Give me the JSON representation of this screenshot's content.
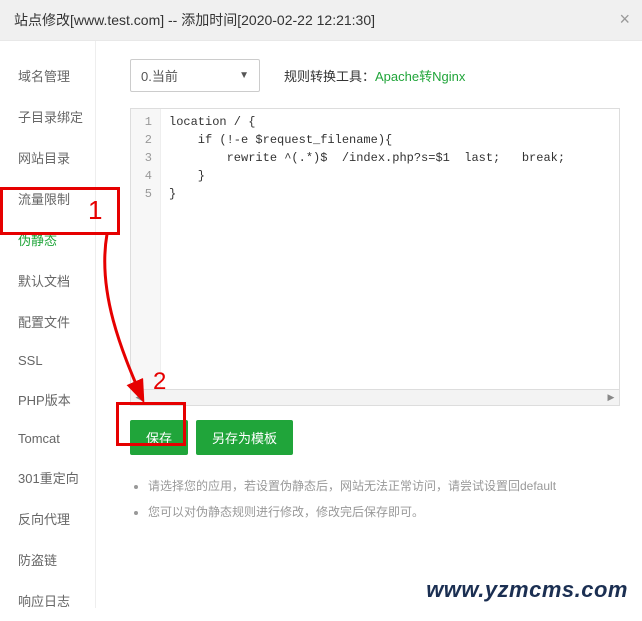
{
  "header": {
    "title": "站点修改[www.test.com] -- 添加时间[2020-02-22 12:21:30]"
  },
  "sidebar": {
    "items": [
      {
        "label": "域名管理"
      },
      {
        "label": "子目录绑定"
      },
      {
        "label": "网站目录"
      },
      {
        "label": "流量限制"
      },
      {
        "label": "伪静态"
      },
      {
        "label": "默认文档"
      },
      {
        "label": "配置文件"
      },
      {
        "label": "SSL"
      },
      {
        "label": "PHP版本"
      },
      {
        "label": "Tomcat"
      },
      {
        "label": "301重定向"
      },
      {
        "label": "反向代理"
      },
      {
        "label": "防盗链"
      },
      {
        "label": "响应日志"
      }
    ],
    "activeIndex": 4
  },
  "main": {
    "select": {
      "value": "0.当前"
    },
    "toolLabel": "规则转换工具：",
    "toolLink": "Apache转Nginx",
    "code": {
      "lines": [
        "1",
        "2",
        "3",
        "4",
        "5"
      ],
      "text": "location / {\n    if (!-e $request_filename){\n        rewrite ^(.*)$  /index.php?s=$1  last;   break;\n    }\n}"
    },
    "buttons": {
      "save": "保存",
      "saveAs": "另存为模板"
    },
    "tips": [
      "请选择您的应用，若设置伪静态后，网站无法正常访问，请尝试设置回default",
      "您可以对伪静态规则进行修改，修改完后保存即可。"
    ]
  },
  "annotations": {
    "num1": "1",
    "num2": "2"
  },
  "watermark": "www.yzmcms.com"
}
